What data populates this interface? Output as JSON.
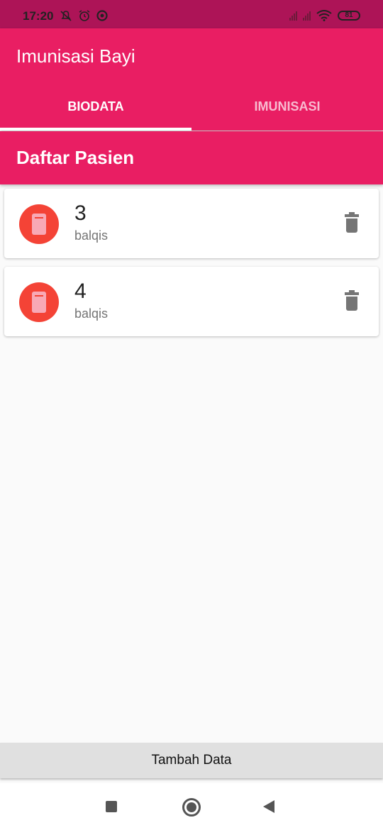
{
  "status": {
    "time": "17:20",
    "battery": "81",
    "left_icons": [
      "silent-bell-icon",
      "alarm-icon",
      "vpn-icon"
    ],
    "right_icons": [
      "signal-icon",
      "signal-icon",
      "wifi-icon",
      "battery-icon"
    ]
  },
  "app": {
    "title": "Imunisasi Bayi",
    "primary_color": "#e91e63"
  },
  "tabs": [
    {
      "label": "BIODATA",
      "selected": true
    },
    {
      "label": "IMUNISASI",
      "selected": false
    }
  ],
  "section": {
    "title": "Daftar Pasien"
  },
  "patients": [
    {
      "number": "3",
      "name": "balqis",
      "icon": "phone-icon",
      "action_icon": "trash-icon"
    },
    {
      "number": "4",
      "name": "balqis",
      "icon": "phone-icon",
      "action_icon": "trash-icon"
    }
  ],
  "add_button": {
    "label": "Tambah Data"
  },
  "nav": {
    "icons": [
      "recents-icon",
      "home-icon",
      "back-icon"
    ]
  }
}
